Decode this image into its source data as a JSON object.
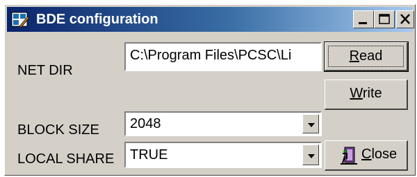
{
  "window": {
    "title": "BDE configuration",
    "icon": "bde-app-icon",
    "caption_buttons": [
      "minimize-icon",
      "maximize-icon",
      "close-icon"
    ]
  },
  "fields": {
    "net_dir": {
      "label": "NET DIR",
      "value": "C:\\Program Files\\PCSC\\Li"
    },
    "block_size": {
      "label": "BLOCK SIZE",
      "value": "2048"
    },
    "local_share": {
      "label": "LOCAL SHARE",
      "value": "TRUE"
    }
  },
  "buttons": {
    "read": {
      "mnemonic": "R",
      "rest": "ead"
    },
    "write": {
      "mnemonic": "W",
      "rest": "rite"
    },
    "close": {
      "mnemonic": "C",
      "rest": "lose",
      "icon": "door-exit-icon"
    }
  },
  "colors": {
    "face": "#d4d0c8",
    "title_start": "#0a246a",
    "title_end": "#a6caf0"
  }
}
